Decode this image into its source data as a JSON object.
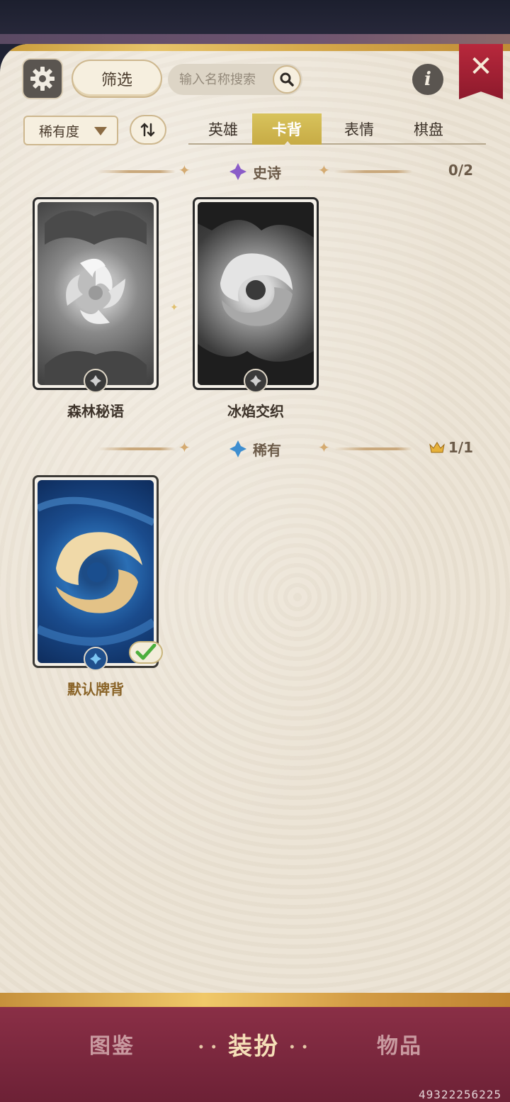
{
  "header": {
    "filter_label": "筛选",
    "search_placeholder": "输入名称搜索"
  },
  "controls": {
    "sort_selected": "稀有度",
    "order_icon": "swap-vertical-icon"
  },
  "tabs": [
    {
      "label": "英雄",
      "active": false
    },
    {
      "label": "卡背",
      "active": true
    },
    {
      "label": "表情",
      "active": false
    },
    {
      "label": "棋盘",
      "active": false
    }
  ],
  "sections": [
    {
      "title": "史诗",
      "count": "0/2",
      "gem_color": "#8a5cc8",
      "cards": [
        {
          "name": "森林秘语",
          "owned": false
        },
        {
          "name": "冰焰交织",
          "owned": false
        }
      ]
    },
    {
      "title": "稀有",
      "count": "1/1",
      "gem_color": "#3e8ed0",
      "cards": [
        {
          "name": "默认牌背",
          "owned": true,
          "equipped": true
        }
      ]
    }
  ],
  "nav": [
    {
      "label": "图鉴",
      "active": false
    },
    {
      "label": "装扮",
      "active": true
    },
    {
      "label": "物品",
      "active": false
    }
  ],
  "watermark": "49322256225",
  "colors": {
    "accent_gold": "#d4b34f",
    "nav_bg": "#7a2a3e",
    "close_red": "#a82236"
  }
}
